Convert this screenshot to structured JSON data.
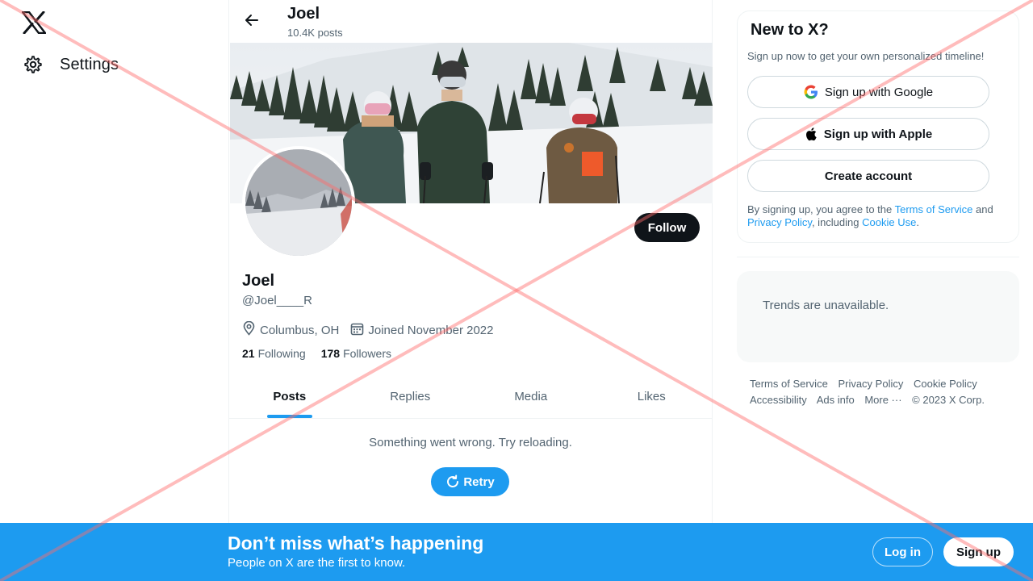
{
  "nav": {
    "logo_icon": "x-logo-icon",
    "settings_label": "Settings"
  },
  "header": {
    "name": "Joel",
    "post_count": "10.4K posts"
  },
  "profile": {
    "name": "Joel",
    "handle": "@Joel____R",
    "location": "Columbus, OH",
    "joined": "Joined November 2022",
    "following_count": "21",
    "following_label": "Following",
    "followers_count": "178",
    "followers_label": "Followers",
    "follow_label": "Follow"
  },
  "tabs": [
    {
      "label": "Posts",
      "active": true
    },
    {
      "label": "Replies",
      "active": false
    },
    {
      "label": "Media",
      "active": false
    },
    {
      "label": "Likes",
      "active": false
    }
  ],
  "feed": {
    "error_message": "Something went wrong. Try reloading.",
    "retry_label": "Retry"
  },
  "signup_card": {
    "title": "New to X?",
    "subtitle": "Sign up now to get your own personalized timeline!",
    "google_label": "Sign up with Google",
    "apple_label": "Sign up with Apple",
    "create_label": "Create account",
    "terms_prefix": "By signing up, you agree to the ",
    "terms_link": "Terms of Service",
    "terms_and": " and ",
    "privacy_link": "Privacy Policy",
    "terms_including": ", including ",
    "cookie_link": "Cookie Use",
    "terms_end": "."
  },
  "trends": {
    "message": "Trends are unavailable."
  },
  "footer": {
    "links": [
      "Terms of Service",
      "Privacy Policy",
      "Cookie Policy",
      "Accessibility",
      "Ads info",
      "More ···"
    ],
    "copyright": "© 2023 X Corp."
  },
  "bottom_bar": {
    "title": "Don’t miss what’s happening",
    "subtitle": "People on X are the first to know.",
    "login_label": "Log in",
    "signup_label": "Sign up"
  },
  "colors": {
    "accent": "#1d9bf0",
    "text_primary": "#0f1419",
    "text_secondary": "#536471",
    "overlay_cross": "#ff6b6b"
  }
}
